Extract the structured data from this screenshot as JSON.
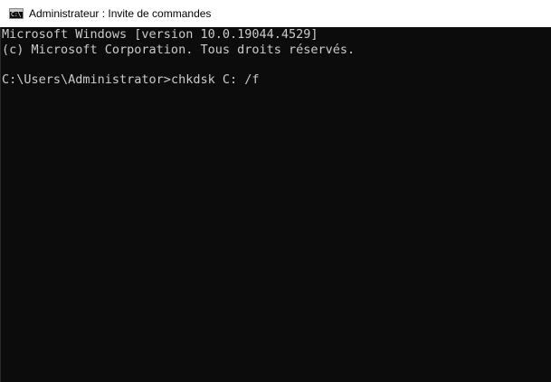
{
  "window": {
    "title": "Administrateur : Invite de commandes",
    "icon": "cmd-icon",
    "icon_glyph": "C:\\"
  },
  "console": {
    "background": "#0c0c0c",
    "foreground": "#cccccc",
    "lines": [
      "Microsoft Windows [version 10.0.19044.4529]",
      "(c) Microsoft Corporation. Tous droits réservés."
    ],
    "prompt": "C:\\Users\\Administrator>",
    "command": "chkdsk C: /f"
  }
}
